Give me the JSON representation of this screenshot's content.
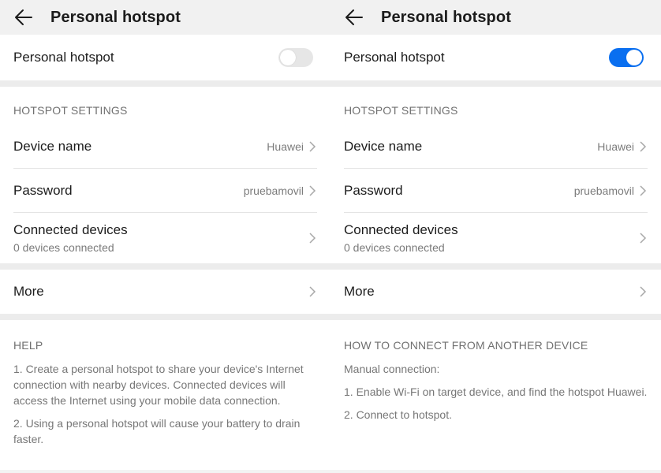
{
  "screens": [
    {
      "appbar": {
        "title": "Personal hotspot",
        "back_icon": "arrow-left-icon"
      },
      "hotspot_toggle": {
        "label": "Personal hotspot",
        "state": "off",
        "color": "#e6e6e6"
      },
      "settings": {
        "header": "HOTSPOT SETTINGS",
        "device_name": {
          "label": "Device name",
          "value": "Huawei"
        },
        "password": {
          "label": "Password",
          "value": "pruebamovil"
        },
        "connected_devices": {
          "label": "Connected devices",
          "sub": "0 devices connected"
        }
      },
      "more": {
        "label": "More"
      },
      "help": {
        "header": "HELP",
        "paragraphs": [
          "1. Create a personal hotspot to share your device's Internet connection with nearby devices. Connected devices will access the Internet using your mobile data connection.",
          "2. Using a personal hotspot will cause your battery to drain faster."
        ]
      }
    },
    {
      "appbar": {
        "title": "Personal hotspot",
        "back_icon": "arrow-left-icon"
      },
      "hotspot_toggle": {
        "label": "Personal hotspot",
        "state": "on",
        "color": "#0a6ff0"
      },
      "settings": {
        "header": "HOTSPOT SETTINGS",
        "device_name": {
          "label": "Device name",
          "value": "Huawei"
        },
        "password": {
          "label": "Password",
          "value": "pruebamovil"
        },
        "connected_devices": {
          "label": "Connected devices",
          "sub": "0 devices connected"
        }
      },
      "more": {
        "label": "More"
      },
      "help": {
        "header": "HOW TO CONNECT FROM ANOTHER DEVICE",
        "paragraphs": [
          "Manual connection:",
          "1. Enable Wi-Fi on target device, and find the hotspot Huawei.",
          "2. Connect to hotspot."
        ]
      }
    }
  ]
}
